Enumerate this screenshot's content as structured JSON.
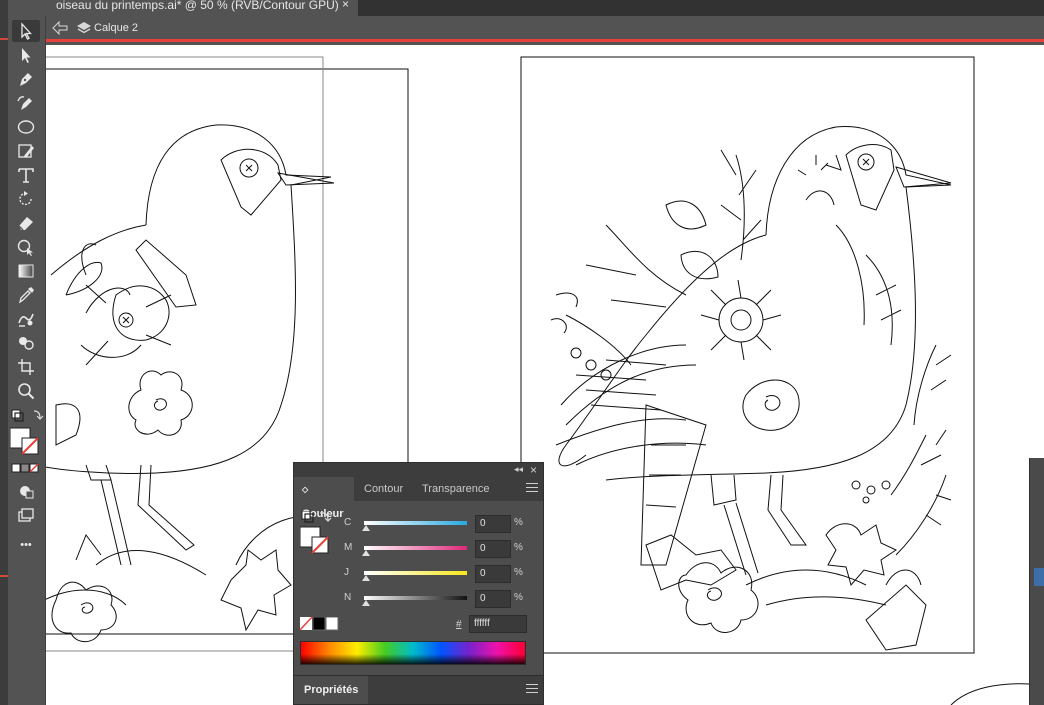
{
  "document": {
    "tab_title": "oiseau du printemps.ai* @ 50 % (RVB/Contour GPU)",
    "close_glyph": "×"
  },
  "isolation_bar": {
    "layer_label": "Calque 2"
  },
  "toolbar": {
    "tools": [
      "selection",
      "direct-selection",
      "pen",
      "curvature",
      "ellipse",
      "pencil",
      "type",
      "rotate",
      "eraser",
      "shape-builder",
      "gradient",
      "eyedropper",
      "blend",
      "symbol-sprayer",
      "artboard",
      "zoom"
    ],
    "more_label": "•••"
  },
  "color_panel": {
    "tabs": [
      "Couleur",
      "Contour",
      "Transparence"
    ],
    "active_tab": "Couleur",
    "tab_arrow": "◇",
    "collapse_glyph": "◂◂",
    "close_glyph": "×",
    "channels": [
      {
        "label": "C",
        "value": "0",
        "unit": "%",
        "gradient": "linear-gradient(to right,#ffffff,#29a9e0)"
      },
      {
        "label": "M",
        "value": "0",
        "unit": "%",
        "gradient": "linear-gradient(to right,#ffffff,#e0287a)"
      },
      {
        "label": "J",
        "value": "0",
        "unit": "%",
        "gradient": "linear-gradient(to right,#ffffff,#f5e71e)"
      },
      {
        "label": "N",
        "value": "0",
        "unit": "%",
        "gradient": "linear-gradient(to right,#ffffff,#111111)"
      }
    ],
    "hex_sign": "#",
    "hex_value": "ffffff"
  },
  "properties_panel": {
    "tab": "Propriétés"
  },
  "colors": {
    "accent_red": "#e8413b",
    "panel_bg": "#4d4d4d",
    "ui_bg": "#535353"
  }
}
